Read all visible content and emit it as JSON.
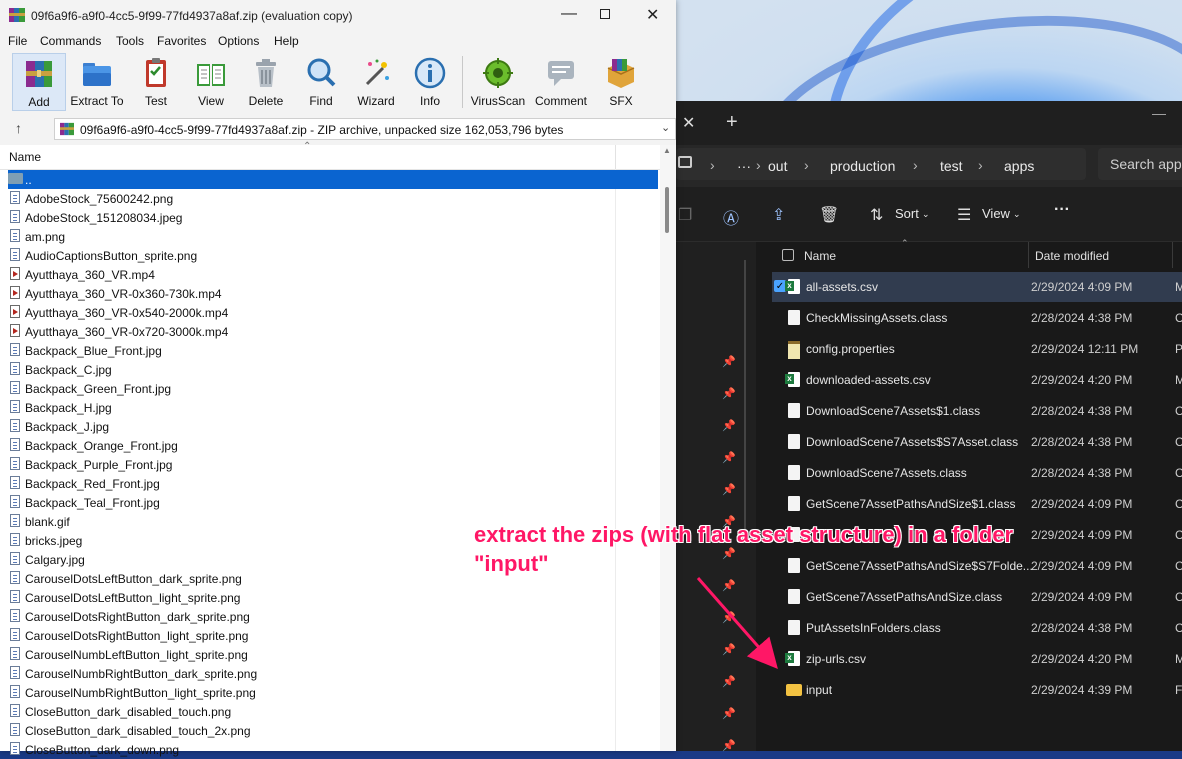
{
  "winrar": {
    "title": "09f6a9f6-a9f0-4cc5-9f99-77fd4937a8af.zip (evaluation copy)",
    "menu": [
      "File",
      "Commands",
      "Tools",
      "Favorites",
      "Options",
      "Help"
    ],
    "tools": [
      {
        "label": "Add",
        "icon": "add-archive-icon"
      },
      {
        "label": "Extract To",
        "icon": "extract-folder-icon"
      },
      {
        "label": "Test",
        "icon": "test-clipboard-icon"
      },
      {
        "label": "View",
        "icon": "view-book-icon"
      },
      {
        "label": "Delete",
        "icon": "delete-bin-icon"
      },
      {
        "label": "Find",
        "icon": "find-magnifier-icon"
      },
      {
        "label": "Wizard",
        "icon": "wizard-wand-icon"
      },
      {
        "label": "Info",
        "icon": "info-icon"
      },
      {
        "label": "VirusScan",
        "icon": "virus-scan-icon"
      },
      {
        "label": "Comment",
        "icon": "comment-icon"
      },
      {
        "label": "SFX",
        "icon": "sfx-box-icon"
      }
    ],
    "path_text": "09f6a9f6-a9f0-4cc5-9f99-77fd4937a8af.zip - ZIP archive, unpacked size 162,053,796 bytes",
    "column_name": "Name",
    "files": [
      {
        "name": "..",
        "type": "folder"
      },
      {
        "name": "AdobeStock_75600242.png",
        "type": "img"
      },
      {
        "name": "AdobeStock_151208034.jpeg",
        "type": "img"
      },
      {
        "name": "am.png",
        "type": "img"
      },
      {
        "name": "AudioCaptionsButton_sprite.png",
        "type": "img"
      },
      {
        "name": "Ayutthaya_360_VR.mp4",
        "type": "vid"
      },
      {
        "name": "Ayutthaya_360_VR-0x360-730k.mp4",
        "type": "vid"
      },
      {
        "name": "Ayutthaya_360_VR-0x540-2000k.mp4",
        "type": "vid"
      },
      {
        "name": "Ayutthaya_360_VR-0x720-3000k.mp4",
        "type": "vid"
      },
      {
        "name": "Backpack_Blue_Front.jpg",
        "type": "img"
      },
      {
        "name": "Backpack_C.jpg",
        "type": "img"
      },
      {
        "name": "Backpack_Green_Front.jpg",
        "type": "img"
      },
      {
        "name": "Backpack_H.jpg",
        "type": "img"
      },
      {
        "name": "Backpack_J.jpg",
        "type": "img"
      },
      {
        "name": "Backpack_Orange_Front.jpg",
        "type": "img"
      },
      {
        "name": "Backpack_Purple_Front.jpg",
        "type": "img"
      },
      {
        "name": "Backpack_Red_Front.jpg",
        "type": "img"
      },
      {
        "name": "Backpack_Teal_Front.jpg",
        "type": "img"
      },
      {
        "name": "blank.gif",
        "type": "img"
      },
      {
        "name": "bricks.jpeg",
        "type": "img"
      },
      {
        "name": "Calgary.jpg",
        "type": "img"
      },
      {
        "name": "CarouselDotsLeftButton_dark_sprite.png",
        "type": "img"
      },
      {
        "name": "CarouselDotsLeftButton_light_sprite.png",
        "type": "img"
      },
      {
        "name": "CarouselDotsRightButton_dark_sprite.png",
        "type": "img"
      },
      {
        "name": "CarouselDotsRightButton_light_sprite.png",
        "type": "img"
      },
      {
        "name": "CarouselNumbLeftButton_light_sprite.png",
        "type": "img"
      },
      {
        "name": "CarouselNumbRightButton_dark_sprite.png",
        "type": "img"
      },
      {
        "name": "CarouselNumbRightButton_light_sprite.png",
        "type": "img"
      },
      {
        "name": "CloseButton_dark_disabled_touch.png",
        "type": "img"
      },
      {
        "name": "CloseButton_dark_disabled_touch_2x.png",
        "type": "img"
      },
      {
        "name": "CloseButton_dark_down.png",
        "type": "img"
      }
    ]
  },
  "explorer": {
    "breadcrumb": [
      "···",
      "out",
      "production",
      "test",
      "apps"
    ],
    "search_placeholder": "Search apps",
    "toolbar": {
      "sort": "Sort",
      "view": "View",
      "more": "···"
    },
    "columns": {
      "name": "Name",
      "date": "Date modified"
    },
    "files": [
      {
        "name": "all-assets.csv",
        "date": "2/29/2024 4:09 PM",
        "kind": "csv",
        "selected": true,
        "more": "M"
      },
      {
        "name": "CheckMissingAssets.class",
        "date": "2/28/2024 4:38 PM",
        "kind": "file",
        "more": "C"
      },
      {
        "name": "config.properties",
        "date": "2/29/2024 12:11 PM",
        "kind": "props",
        "more": "P"
      },
      {
        "name": "downloaded-assets.csv",
        "date": "2/29/2024 4:20 PM",
        "kind": "csv",
        "more": "M"
      },
      {
        "name": "DownloadScene7Assets$1.class",
        "date": "2/28/2024 4:38 PM",
        "kind": "file",
        "more": "C"
      },
      {
        "name": "DownloadScene7Assets$S7Asset.class",
        "date": "2/28/2024 4:38 PM",
        "kind": "file",
        "more": "C"
      },
      {
        "name": "DownloadScene7Assets.class",
        "date": "2/28/2024 4:38 PM",
        "kind": "file",
        "more": "C"
      },
      {
        "name": "GetScene7AssetPathsAndSize$1.class",
        "date": "2/29/2024 4:09 PM",
        "kind": "file",
        "more": "C"
      },
      {
        "name": "",
        "date": "2/29/2024 4:09 PM",
        "kind": "file",
        "more": "C"
      },
      {
        "name": "GetScene7AssetPathsAndSize$S7Folde...",
        "date": "2/29/2024 4:09 PM",
        "kind": "file",
        "more": "C"
      },
      {
        "name": "GetScene7AssetPathsAndSize.class",
        "date": "2/29/2024 4:09 PM",
        "kind": "file",
        "more": "C"
      },
      {
        "name": "PutAssetsInFolders.class",
        "date": "2/28/2024 4:38 PM",
        "kind": "file",
        "more": "C"
      },
      {
        "name": "zip-urls.csv",
        "date": "2/29/2024 4:20 PM",
        "kind": "csv",
        "more": "M"
      },
      {
        "name": "input",
        "date": "2/29/2024 4:39 PM",
        "kind": "folder",
        "more": "F"
      }
    ]
  },
  "annotation": {
    "line1": "extract the zips (with flat asset structure) in a folder",
    "line2": "\"input\"",
    "color": "#ff1766"
  },
  "colors": {
    "selection": "#0a64d0",
    "explorer_bg": "#1c1c1c",
    "winrar_bg": "#f3f3f3"
  }
}
